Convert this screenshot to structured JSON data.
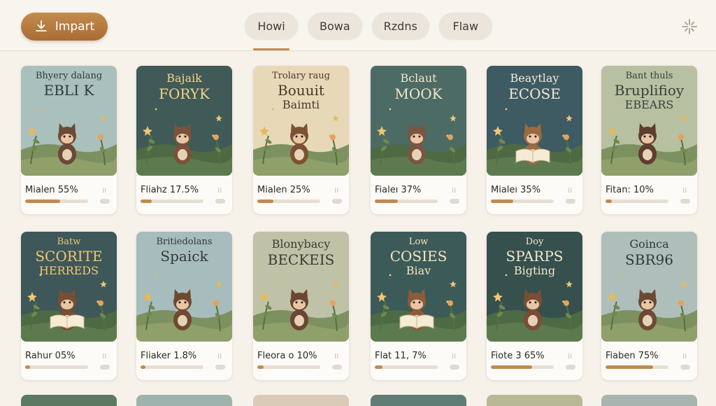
{
  "toolbar": {
    "import_label": "Impart",
    "tabs": [
      "Howi",
      "Bowa",
      "Rzdns",
      "Flaw"
    ],
    "active_tab": 0
  },
  "icons": {
    "import": "download-icon",
    "sync": "sync-icon",
    "card_menu": "more-icon"
  },
  "colors": {
    "accent": "#c18a4f",
    "background": "#f6f1e9"
  },
  "books": [
    {
      "title_lines": [
        "Bhyery dalang",
        "EBLI K"
      ],
      "progress_label": "Mialen 55%",
      "progress": 0.55,
      "cover": "#a9c0bc",
      "text": "#2f3b3a",
      "creature": "#6b4a36"
    },
    {
      "title_lines": [
        "Bajaik",
        "FORYK"
      ],
      "progress_label": "Fliahz 17.5%",
      "progress": 0.175,
      "cover": "#3f5a57",
      "text": "#f3d28c",
      "creature": "#7b5239"
    },
    {
      "title_lines": [
        "Trolary raug",
        "Bouuit",
        "Baimti"
      ],
      "progress_label": "Mialen 25%",
      "progress": 0.25,
      "cover": "#e7d8b8",
      "text": "#4a3a2d",
      "creature": "#7a5232"
    },
    {
      "title_lines": [
        "Bclaut",
        "MOOK"
      ],
      "progress_label": "Fialeı 37%",
      "progress": 0.37,
      "cover": "#4c6b64",
      "text": "#f3e6c8",
      "creature": "#7b5542"
    },
    {
      "title_lines": [
        "Beaytlay",
        "ECOSE"
      ],
      "progress_label": "Mialeı 35%",
      "progress": 0.35,
      "cover": "#3e5a63",
      "text": "#f2ead8",
      "creature": "#9b6a3f"
    },
    {
      "title_lines": [
        "Bant thuls",
        "Bruplifioy",
        "EBEARS"
      ],
      "progress_label": "Fitan: 10%",
      "progress": 0.1,
      "cover": "#b7c0a1",
      "text": "#37423b",
      "creature": "#5e3e2f"
    },
    {
      "title_lines": [
        "Batw",
        "SCORITE",
        "HERREDS"
      ],
      "progress_label": "Rahur 05%",
      "progress": 0.05,
      "cover": "#3e5759",
      "text": "#f0c774",
      "creature": "#7a4e33"
    },
    {
      "title_lines": [
        "Britiedolans",
        "Spaick"
      ],
      "progress_label": "Fliaker 1.8%",
      "progress": 0.018,
      "cover": "#a7bcbc",
      "text": "#2e3a38",
      "creature": "#6e4a30"
    },
    {
      "title_lines": [
        "Blonybacy",
        "BECKEIS"
      ],
      "progress_label": "Fleora o 10%",
      "progress": 0.1,
      "cover": "#bfc2a7",
      "text": "#3c3a32",
      "creature": "#6a4633"
    },
    {
      "title_lines": [
        "Low",
        "COSIES",
        "Biav"
      ],
      "progress_label": "Flat 11, 7%",
      "progress": 0.117,
      "cover": "#3c5a58",
      "text": "#f4e5c3",
      "creature": "#8d5b3a"
    },
    {
      "title_lines": [
        "Doy",
        "SPARPS",
        "Bigting"
      ],
      "progress_label": "Fiote 3 65%",
      "progress": 0.65,
      "cover": "#35504d",
      "text": "#f1e7cd",
      "creature": "#7a4e35"
    },
    {
      "title_lines": [
        "Goinca",
        "SBR96"
      ],
      "progress_label": "Fiaben 75%",
      "progress": 0.75,
      "cover": "#aebfbb",
      "text": "#2d3937",
      "creature": "#6d4a34"
    }
  ],
  "partial_rows": [
    "#5c7a62",
    "#9eb3ad",
    "#d9cbb7",
    "#5f7d74",
    "#b8b896",
    "#a7b4b0"
  ]
}
